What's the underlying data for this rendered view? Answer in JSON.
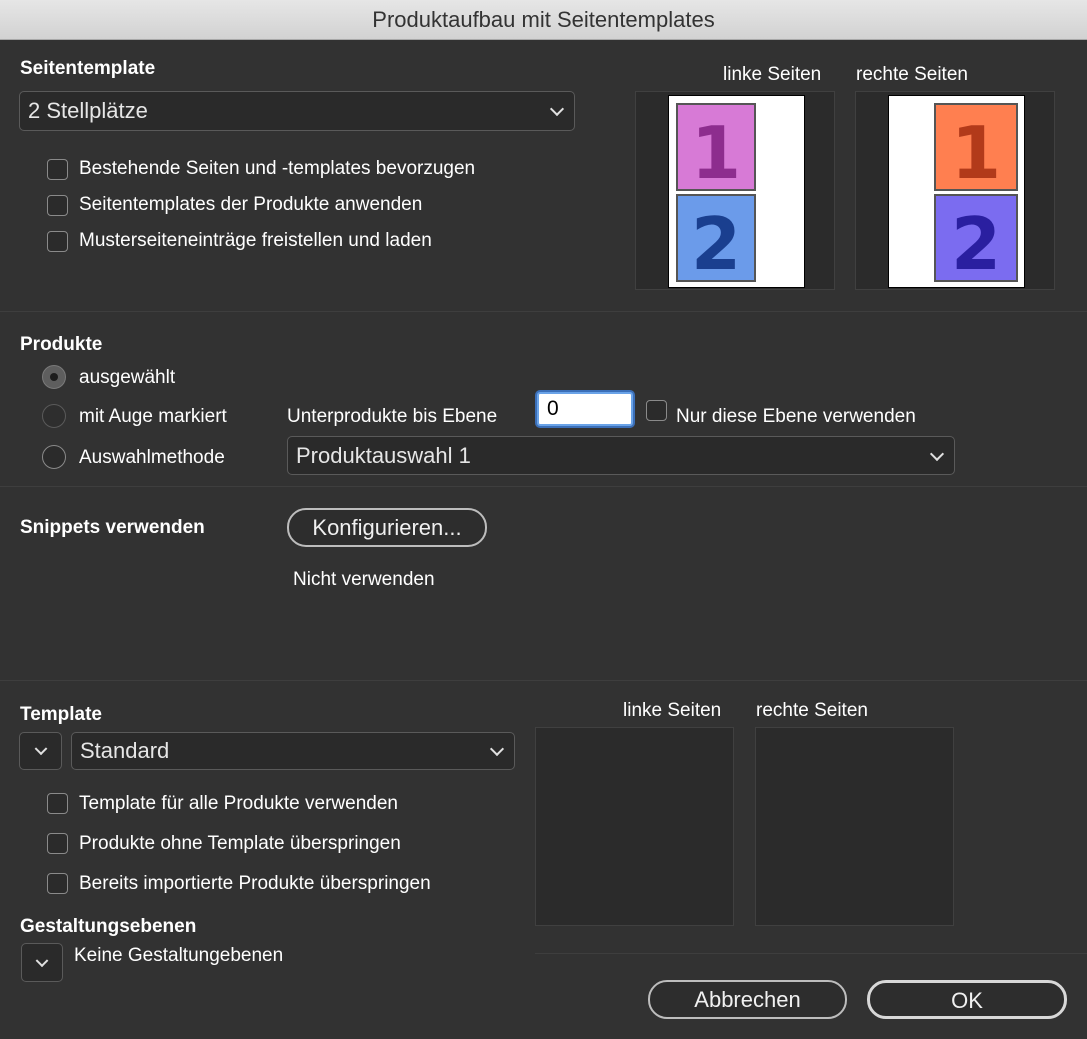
{
  "window": {
    "title": "Produktaufbau mit Seitentemplates"
  },
  "seitentemplate": {
    "title": "Seitentemplate",
    "selected": "2 Stellplätze",
    "options": [
      {
        "label": "Bestehende Seiten und -templates bevorzugen",
        "checked": false
      },
      {
        "label": "Seitentemplates der Produkte anwenden",
        "checked": false
      },
      {
        "label": "Musterseiteneinträge freistellen und laden",
        "checked": false
      }
    ],
    "preview_left_label": "linke Seiten",
    "preview_right_label": "rechte Seiten",
    "left_slots": [
      {
        "number": "1",
        "color": "#d77ad6",
        "text_color": "#8d2d8e"
      },
      {
        "number": "2",
        "color": "#6b9bea",
        "text_color": "#1a3f8f"
      }
    ],
    "right_slots": [
      {
        "number": "1",
        "color": "#ff7f50",
        "text_color": "#b23a1a"
      },
      {
        "number": "2",
        "color": "#7b6cf0",
        "text_color": "#2a1fa0"
      }
    ]
  },
  "produkte": {
    "title": "Produkte",
    "radio_selected": "ausgewählt",
    "radio_eye": "mit Auge markiert",
    "radio_method": "Auswahlmethode",
    "sublevel_label": "Unterprodukte bis Ebene",
    "sublevel_value": "0",
    "only_level_label": "Nur diese Ebene verwenden",
    "method_selected": "Produktauswahl 1"
  },
  "snippets": {
    "title": "Snippets verwenden",
    "configure_button": "Konfigurieren...",
    "status": "Nicht verwenden"
  },
  "template": {
    "title": "Template",
    "selected": "Standard",
    "preview_left_label": "linke Seiten",
    "preview_right_label": "rechte Seiten",
    "options": [
      {
        "label": "Template für alle Produkte verwenden",
        "checked": false
      },
      {
        "label": "Produkte ohne Template überspringen",
        "checked": false
      },
      {
        "label": "Bereits importierte Produkte überspringen",
        "checked": false
      }
    ]
  },
  "gestaltung": {
    "title": "Gestaltungsebenen",
    "value": "Keine Gestaltungebenen"
  },
  "buttons": {
    "cancel": "Abbrechen",
    "ok": "OK"
  }
}
